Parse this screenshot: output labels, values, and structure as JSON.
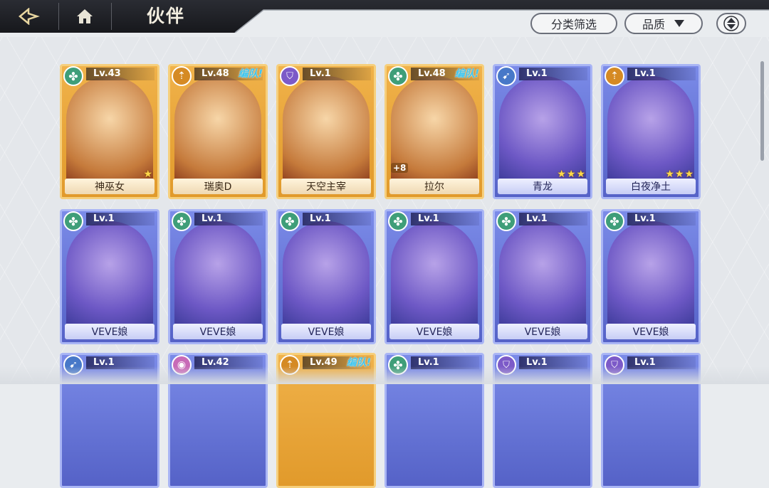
{
  "header": {
    "title": "伙伴",
    "filter_label": "分类筛选",
    "quality_label": "品质"
  },
  "cards_row1": [
    {
      "level": "Lv.43",
      "name": "神巫女",
      "team": "",
      "stars": "★",
      "plus": "",
      "frame": "gold",
      "role": "green"
    },
    {
      "level": "Lv.48",
      "name": "瑞奥D",
      "team": "编队!",
      "stars": "",
      "plus": "",
      "frame": "gold",
      "role": "gold"
    },
    {
      "level": "Lv.1",
      "name": "天空主宰",
      "team": "",
      "stars": "",
      "plus": "",
      "frame": "gold",
      "role": "purple"
    },
    {
      "level": "Lv.48",
      "name": "拉尔",
      "team": "编队!",
      "stars": "",
      "plus": "+8",
      "frame": "gold",
      "role": "green"
    },
    {
      "level": "Lv.1",
      "name": "青龙",
      "team": "",
      "stars": "★★★",
      "plus": "",
      "frame": "blue",
      "role": "blue"
    },
    {
      "level": "Lv.1",
      "name": "白夜净土",
      "team": "",
      "stars": "★★★",
      "plus": "",
      "frame": "blue",
      "role": "gold"
    }
  ],
  "cards_row2": [
    {
      "level": "Lv.1",
      "name": "VEVE娘"
    },
    {
      "level": "Lv.1",
      "name": "VEVE娘"
    },
    {
      "level": "Lv.1",
      "name": "VEVE娘"
    },
    {
      "level": "Lv.1",
      "name": "VEVE娘"
    },
    {
      "level": "Lv.1",
      "name": "VEVE娘"
    },
    {
      "level": "Lv.1",
      "name": "VEVE娘"
    }
  ],
  "cards_row3": [
    {
      "level": "Lv.1",
      "team": "",
      "frame": "blue",
      "role": "blue"
    },
    {
      "level": "Lv.42",
      "team": "",
      "frame": "blue",
      "role": "pink"
    },
    {
      "level": "Lv.49",
      "team": "编队!",
      "frame": "gold",
      "role": "gold"
    },
    {
      "level": "Lv.1",
      "team": "",
      "frame": "blue",
      "role": "green"
    },
    {
      "level": "Lv.1",
      "team": "",
      "frame": "blue",
      "role": "purple"
    },
    {
      "level": "Lv.1",
      "team": "",
      "frame": "blue",
      "role": "purple"
    }
  ]
}
